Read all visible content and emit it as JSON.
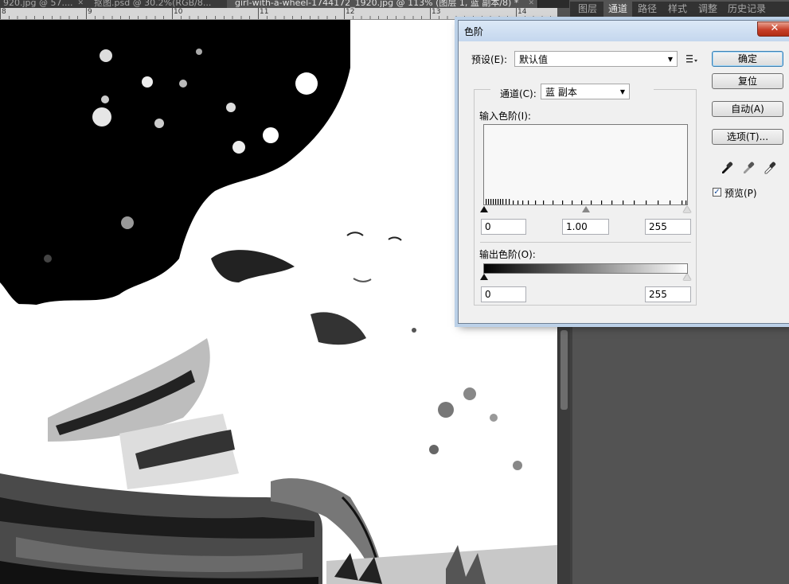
{
  "document_tabs": [
    {
      "label": "920.jpg @ 57....",
      "active": false
    },
    {
      "label": "抠图.psd @ 30.2%(RGB/8...",
      "active": false
    },
    {
      "label": "girl-with-a-wheel-1744172_1920.jpg @ 113% (图层 1, 蓝 副本/8) *",
      "active": true
    }
  ],
  "ruler_numbers": [
    "8",
    "9",
    "10",
    "11",
    "12",
    "13",
    "14"
  ],
  "panel_tabs": [
    "图层",
    "通道",
    "路径",
    "样式",
    "调整",
    "历史记录"
  ],
  "panel_active_tab": "通道",
  "dialog": {
    "title": "色阶",
    "close_glyph": "✕",
    "preset_label": "预设(E):",
    "preset_value": "默认值",
    "channel_label": "通道(C):",
    "channel_value": "蓝 副本",
    "input_levels_label": "输入色阶(I):",
    "input_black": "0",
    "input_gamma": "1.00",
    "input_white": "255",
    "output_levels_label": "输出色阶(O):",
    "output_black": "0",
    "output_white": "255",
    "buttons": {
      "ok": "确定",
      "reset": "复位",
      "auto": "自动(A)",
      "options": "选项(T)..."
    },
    "preview_label": "预览(P)",
    "preview_checked": true,
    "dropper_icons": [
      "black-point-eyedropper-icon",
      "gray-point-eyedropper-icon",
      "white-point-eyedropper-icon"
    ]
  },
  "colors": {
    "app_bg": "#535353",
    "dialog_bg": "#f0f0f0",
    "close_red": "#c7402a"
  }
}
